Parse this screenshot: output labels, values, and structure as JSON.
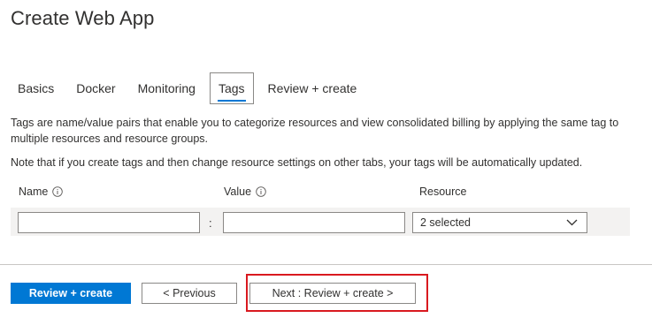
{
  "page": {
    "title": "Create Web App"
  },
  "tabs": [
    {
      "label": "Basics",
      "active": false
    },
    {
      "label": "Docker",
      "active": false
    },
    {
      "label": "Monitoring",
      "active": false
    },
    {
      "label": "Tags",
      "active": true
    },
    {
      "label": "Review + create",
      "active": false
    }
  ],
  "content": {
    "description": "Tags are name/value pairs that enable you to categorize resources and view consolidated billing by applying the same tag to multiple resources and resource groups.",
    "note": "Note that if you create tags and then change resource settings on other tabs, your tags will be automatically updated."
  },
  "table": {
    "headers": {
      "name": "Name",
      "value": "Value",
      "resource": "Resource"
    },
    "row": {
      "name_value": "",
      "value_value": "",
      "separator": ":",
      "resource_selected": "2 selected"
    }
  },
  "footer": {
    "review_create_label": "Review + create",
    "previous_label": "< Previous",
    "next_label": "Next : Review + create >"
  },
  "colors": {
    "primary": "#0078d4",
    "highlight": "#d9191f",
    "text": "#323130",
    "row_background": "#f3f2f1"
  },
  "icons": {
    "info": "info-icon",
    "dropdown": "chevron-down-icon"
  }
}
